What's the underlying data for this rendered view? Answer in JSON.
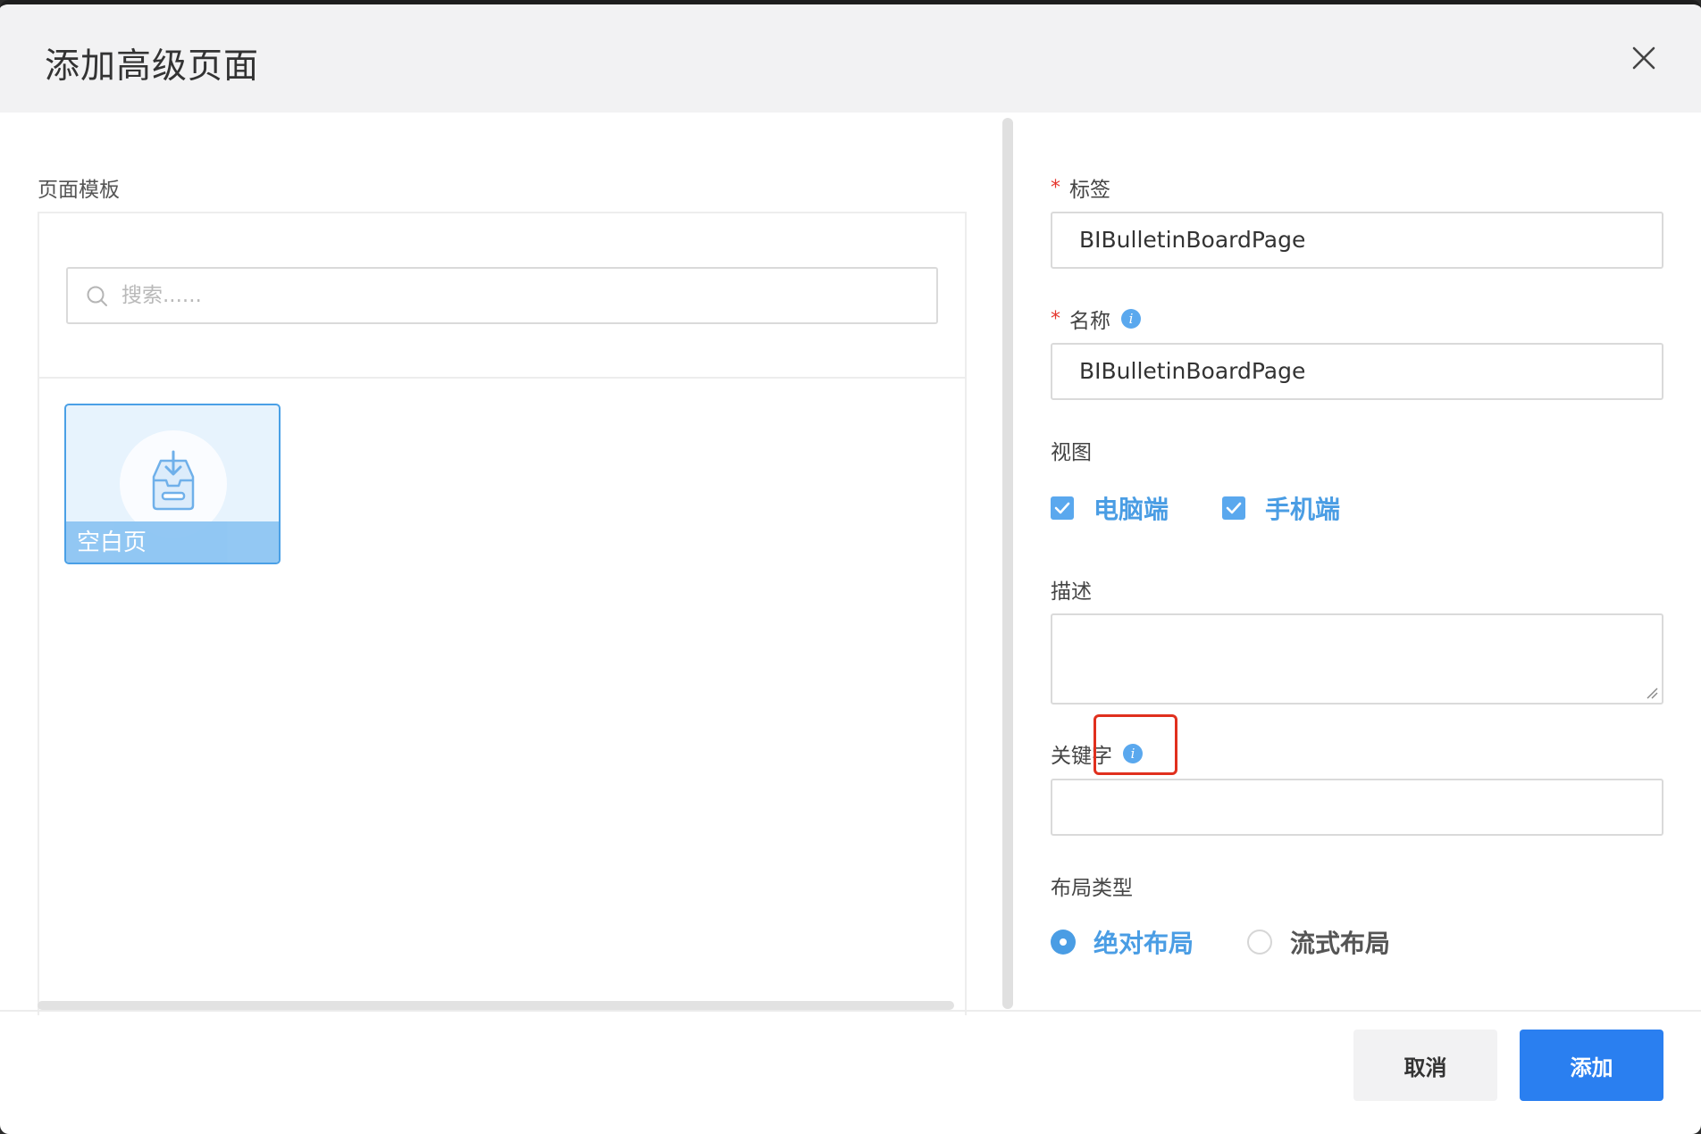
{
  "dialog": {
    "title": "添加高级页面"
  },
  "left": {
    "section_label": "页面模板",
    "search": {
      "placeholder": "搜索......"
    },
    "templates": [
      {
        "caption": "空白页",
        "icon": "inbox-download-icon"
      }
    ]
  },
  "right": {
    "label_field": {
      "label": "标签",
      "required_mark": "*",
      "value": "BIBulletinBoardPage"
    },
    "name_field": {
      "label": "名称",
      "required_mark": "*",
      "value": "BIBulletinBoardPage",
      "info_icon": "i"
    },
    "view": {
      "label": "视图",
      "options": [
        {
          "label": "电脑端",
          "checked": true
        },
        {
          "label": "手机端",
          "checked": true
        }
      ]
    },
    "description": {
      "label": "描述",
      "value": ""
    },
    "keywords": {
      "label": "关键字",
      "info_icon": "i",
      "value": ""
    },
    "layout_type": {
      "label": "布局类型",
      "options": [
        {
          "label": "绝对布局",
          "selected": true
        },
        {
          "label": "流式布局",
          "selected": false
        }
      ]
    }
  },
  "footer": {
    "cancel_label": "取消",
    "add_label": "添加"
  },
  "colors": {
    "accent": "#4a9de4",
    "primary_button": "#2a7ff0",
    "required": "#e5372e",
    "highlight": "#e0301e"
  }
}
